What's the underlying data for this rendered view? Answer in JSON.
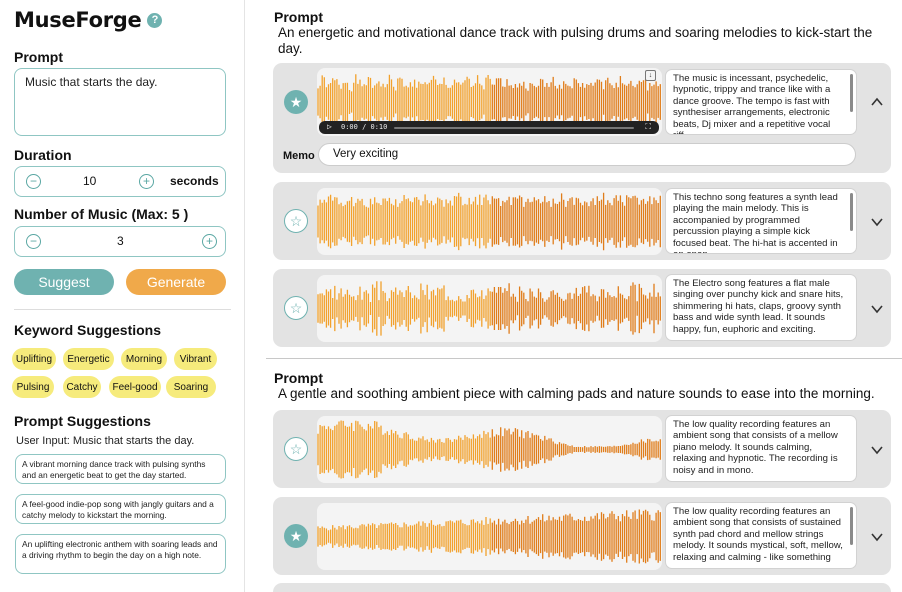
{
  "app": {
    "title": "MuseForge",
    "help_glyph": "?"
  },
  "sidebar": {
    "prompt_label": "Prompt",
    "prompt_value": "Music that starts the day.",
    "duration_label": "Duration",
    "duration_value": "10",
    "duration_unit": "seconds",
    "count_label": "Number of Music (Max: 5 )",
    "count_value": "3",
    "minus_glyph": "−",
    "plus_glyph": "+",
    "suggest_label": "Suggest",
    "generate_label": "Generate",
    "keyword_title": "Keyword Suggestions",
    "keywords": [
      "Uplifting",
      "Energetic",
      "Morning",
      "Vibrant",
      "Pulsing",
      "Catchy",
      "Feel-good",
      "Soaring"
    ],
    "prompt_sugg_title": "Prompt Suggestions",
    "user_input": "User Input: Music that starts the day.",
    "suggestions": [
      "A vibrant morning dance track with pulsing synths and an energetic beat to get the day started.",
      "A feel-good indie-pop song with jangly guitars and a catchy melody to kickstart the morning.",
      "An uplifting electronic anthem with soaring leads and a driving rhythm to begin the day on a high note."
    ]
  },
  "groups": [
    {
      "label": "Prompt",
      "text": "An energetic and motivational dance track with pulsing drums and soaring melodies to kick-start the day.",
      "tracks": [
        {
          "starred": true,
          "expanded": true,
          "description": "The music is incessant, psychedelic, hypnotic, trippy and trance like with a dance groove. The tempo is fast with synthesiser arrangements, electronic beats, Dj mixer and a repetitive vocal riff.",
          "player_time": "0:00 / 0:10",
          "memo_label": "Memo",
          "memo": "Very exciting"
        },
        {
          "starred": false,
          "expanded": false,
          "description": "This techno song features a synth lead playing the main melody. This is accompanied by programmed percussion playing a simple kick focused beat. The hi-hat is accented in an open"
        },
        {
          "starred": false,
          "expanded": false,
          "description": "The Electro song features a flat male singing over punchy kick and snare hits, shimmering hi hats, claps, groovy synth bass and wide synth lead. It sounds happy, fun, euphoric and exciting."
        }
      ]
    },
    {
      "label": "Prompt",
      "text": "A gentle and soothing ambient piece with calming pads and nature sounds to ease into the morning.",
      "tracks": [
        {
          "starred": false,
          "expanded": false,
          "description": "The low quality recording features an ambient song that consists of a mellow piano melody. It sounds calming, relaxing and hypnotic. The recording is noisy and in mono."
        },
        {
          "starred": true,
          "expanded": false,
          "description": "The low quality recording features an ambient song that consists of sustained synth pad chord and mellow strings melody. It sounds mystical, soft, mellow, relaxing and calming - like something"
        }
      ]
    }
  ],
  "icons": {
    "star_filled": "★",
    "star_empty": "☆",
    "download": "↓",
    "play": "▷",
    "fullscreen": "⛶"
  },
  "colors": {
    "accent_teal": "#6fb2b0",
    "accent_orange": "#f0a94a",
    "chip_yellow": "#f6eb7c",
    "wave_orange": "#f2a12c",
    "wave_dark": "#e07d1a"
  }
}
